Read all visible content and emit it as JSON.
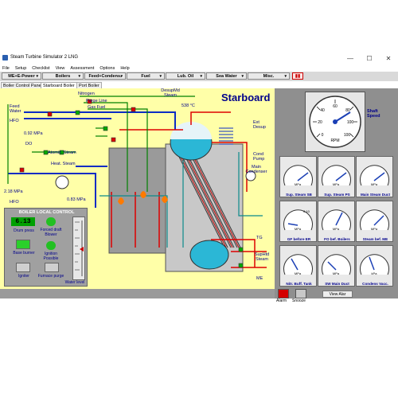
{
  "window": {
    "title": "Steam Turbine Simulator 2 LNG"
  },
  "menu": [
    "File",
    "Setup",
    "Checklist",
    "View",
    "Assessment",
    "Options",
    "Help"
  ],
  "toolbar": [
    "ME+E-Power",
    "Boilers",
    "Feed+Condens.",
    "Fuel",
    "Lub. Oil",
    "Sea Water",
    "Misc."
  ],
  "tabs": [
    "Boiler Control Panel",
    "Starboard Boiler",
    "Port Boiler"
  ],
  "active_tab": "Starboard Boiler",
  "diagram": {
    "heading": "Starboard",
    "labels": {
      "nitrogen": "Nitrogen",
      "purge_line": "Purge Line",
      "gas_fuel": "Gas Fuel",
      "desupmd_steam": "DesupMd Steam",
      "feed_water": "Feed Water",
      "hfo_top": "HFO",
      "pressure_1": "0.92 MPa",
      "do": "DO",
      "atomiz_steam": "Atomiz. Steam",
      "heat_steam": "Heat. Steam",
      "ext_desup": "Ext Desup",
      "cond_pump": "Cond Pump",
      "main_condenser": "Main Condenser",
      "pressure_2": "2.18 MPa",
      "hfo_bottom": "HFO",
      "pressure_3": "0.83 MPa",
      "temp": "538 °C",
      "tg": "TG",
      "suphtd_steam": "SupHtd Steam",
      "me": "ME"
    }
  },
  "boiler_local_control": {
    "title": "BOILER LOCAL CONTROL",
    "drum_value": "6.13",
    "drum_press": "Drum press",
    "forced_draft": "Forced draft Blower",
    "base_burner": "Base burner",
    "ignition_possible": "Ignition Possible",
    "igniter": "Igniter",
    "furnace_purge": "Furnace purge",
    "water_level": "Water level"
  },
  "gauges": {
    "shaft": {
      "caption": "Shaft Speed",
      "unit": "RPM",
      "ticks": [
        "0",
        "20",
        "40",
        "60",
        "80",
        "100",
        "100"
      ]
    },
    "small": [
      {
        "caption": "Sup. Steam SB",
        "unit": "MPa"
      },
      {
        "caption": "Sup. Steam PS",
        "unit": "MPa"
      },
      {
        "caption": "Main Steam Duct",
        "unit": "MPa"
      },
      {
        "caption": "GF before ER",
        "unit": "MPa",
        "max": "0.10"
      },
      {
        "caption": "FO bef. Boilers",
        "unit": "MPa"
      },
      {
        "caption": "Steam bef. ME",
        "unit": "MPa"
      },
      {
        "caption": "Nitr. Buff. Tank",
        "unit": "MPa"
      },
      {
        "caption": "SW Main Duct",
        "unit": "MPa"
      },
      {
        "caption": "Condens Vacc.",
        "unit": "kPa"
      }
    ]
  },
  "bottom": {
    "alarm": "Alarm",
    "snooze": "Snooze",
    "view_alarms": "View Alar"
  }
}
